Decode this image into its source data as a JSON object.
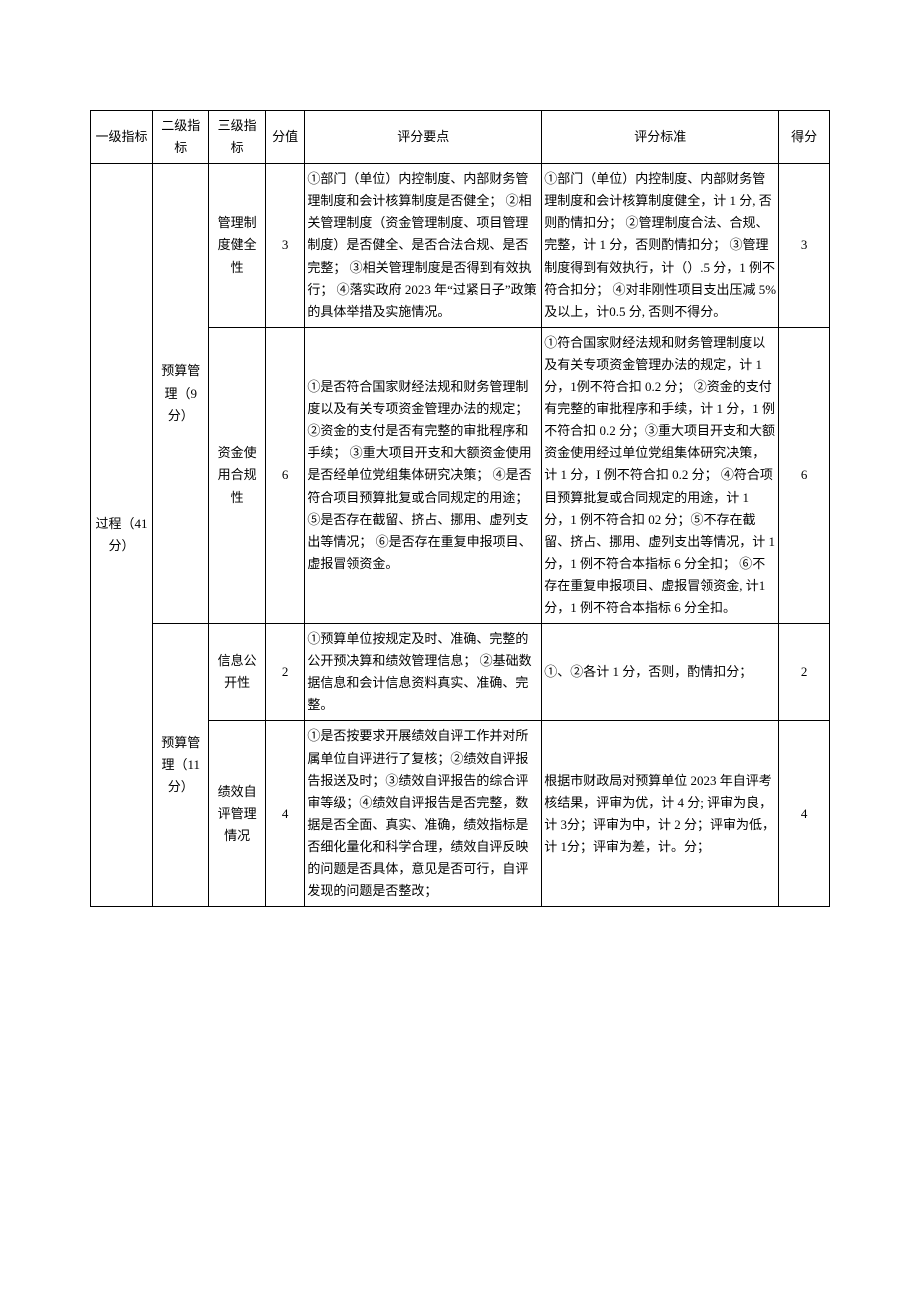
{
  "headers": {
    "l1": "一级指标",
    "l2": "二级指标",
    "l3": "三级指标",
    "score_value": "分值",
    "points": "评分要点",
    "standard": "评分标准",
    "score": "得分"
  },
  "l1": {
    "name": "过程（41 分）"
  },
  "l2a": {
    "name": "预算管理（9分）"
  },
  "l2b": {
    "name": "预算管理（11分）"
  },
  "rows": [
    {
      "l3": "管理制度健全性",
      "sv": "3",
      "points": "①部门（单位）内控制度、内部财务管理制度和会计核算制度是否健全；\n②相关管理制度（资金管理制度、项目管理制度）是否健全、是否合法合规、是否完整；\n③相关管理制度是否得到有效执行；\n④落实政府 2023 年“过紧日子”政策的具体举措及实施情况。",
      "standard": "①部门（单位）内控制度、内部财务管理制度和会计核算制度健全，计 1 分, 否则酌情扣分；\n②管理制度合法、合规、完整，计 1 分，否则酌情扣分；\n③管理制度得到有效执行，计（）.5 分，1 例不符合扣分；\n④对非刚性项目支出压减 5%及以上，计0.5 分, 否则不得分。",
      "score": "3"
    },
    {
      "l3": "资金使用合规性",
      "sv": "6",
      "points": "①是否符合国家财经法规和财务管理制度以及有关专项资金管理办法的规定；\n②资金的支付是否有完整的审批程序和手续；\n③重大项目开支和大额资金使用是否经单位党组集体研究决策；\n④是否符合项目预算批复或合同规定的用途；\n⑤是否存在截留、挤占、挪用、虚列支出等情况；\n⑥是否存在重复申报项目、虚报冒领资金。",
      "standard": "①符合国家财经法规和财务管理制度以及有关专项资金管理办法的规定，计 1 分，1例不符合扣 0.2 分；\n②资金的支付有完整的审批程序和手续，计 1 分，1 例不符合扣 0.2 分；③重大项目开支和大额资金使用经过单位党组集体研究决策，计 1 分，I 例不符合扣 0.2 分；\n④符合项目预算批复或合同规定的用途，计 1 分，1 例不符合扣 02 分；⑤不存在截留、挤占、挪用、虚列支出等情况，计 1分，1 例不符合本指标 6 分全扣；\n⑥不存在重复申报项目、虚报冒领资金, 计1 分，1 例不符合本指标 6 分全扣。",
      "score": "6"
    },
    {
      "l3": "信息公开性",
      "sv": "2",
      "points": "①预算单位按规定及时、准确、完整的公开预决算和绩效管理信息；\n②基础数据信息和会计信息资料真实、准确、完整。",
      "standard": "①、②各计 1 分，否则，酌情扣分；",
      "score": "2"
    },
    {
      "l3": "绩效自评管理情况",
      "sv": "4",
      "points": "①是否按要求开展绩效自评工作并对所属单位自评进行了复核；②绩效自评报告报送及时；③绩效自评报告的综合评审等级；④绩效自评报告是否完整，数据是否全面、真实、准确，绩效指标是否细化量化和科学合理，绩效自评反映的问题是否具体，意见是否可行，自评发现的问题是否整改；",
      "standard": "根据市财政局对预算单位 2023 年自评考核结果，评审为优，计 4 分; 评审为良，计 3分；评审为中，计 2 分；评审为低，计 1分；评审为差，计。分；",
      "score": "4"
    }
  ]
}
